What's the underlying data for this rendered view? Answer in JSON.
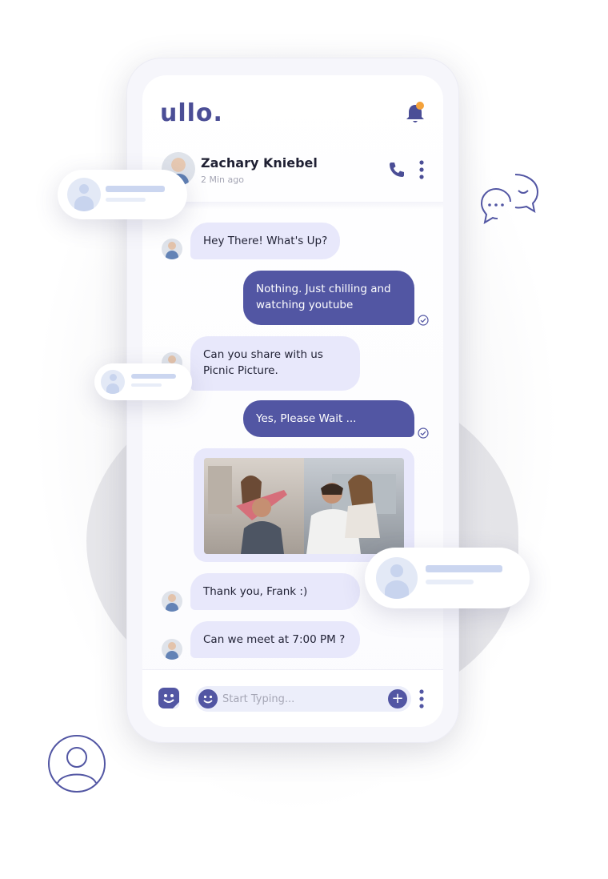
{
  "app": {
    "logo": "ullo."
  },
  "contact": {
    "name": "Zachary Kniebel",
    "status": "2 Min ago"
  },
  "messages": [
    {
      "dir": "in",
      "text": "Hey There! What's Up?"
    },
    {
      "dir": "out",
      "line1": "Nothing. Just chilling and",
      "line2": "watching youtube"
    },
    {
      "dir": "in",
      "line1": "Can you share with us",
      "line2": "Picnic Picture."
    },
    {
      "dir": "out",
      "text": "Yes, Please Wait ..."
    },
    {
      "dir": "in",
      "text": "Thank you, Frank :)"
    },
    {
      "dir": "in",
      "text": "Can we meet at 7:00 PM ?"
    }
  ],
  "compose": {
    "placeholder": "Start Typing...",
    "add_label": "+"
  },
  "colors": {
    "brand": "#4b4e96",
    "bubble_out": "#5256a3",
    "bubble_in": "#e8e8fb",
    "notification": "#f4a23b"
  },
  "icons": [
    "bell-icon",
    "phone-icon",
    "more-vertical-icon",
    "check-circle-icon",
    "sticker-icon",
    "emoji-icon",
    "plus-icon",
    "chat-bubbles-icon",
    "user-circle-icon"
  ]
}
